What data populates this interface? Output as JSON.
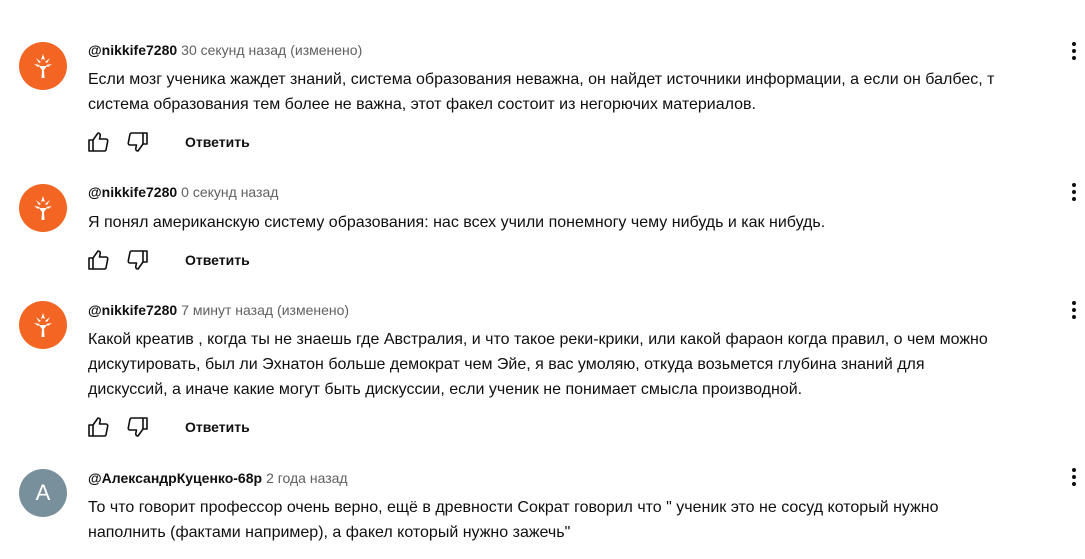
{
  "comments": [
    {
      "author": "@nikkife7280",
      "time": "30 секунд назад",
      "edited": "(изменено)",
      "lines": [
        "Если мозг ученика жаждет знаний, система образования неважна, он найдет источники информации, а если он балбес, т",
        "система образования тем более не важна, этот факел состоит из негорючих материалов."
      ],
      "reply_label": "Ответить",
      "avatar_icon": "torch-icon"
    },
    {
      "author": "@nikkife7280",
      "time": "0 секунд назад",
      "edited": "",
      "lines": [
        "Я понял американскую систему образования: нас всех учили понемногу чему нибудь и как нибудь."
      ],
      "reply_label": "Ответить",
      "avatar_icon": "torch-icon"
    },
    {
      "author": "@nikkife7280",
      "time": "7 минут назад",
      "edited": "(изменено)",
      "lines": [
        "Какой креатив , когда ты не знаешь где Австралия, и что такое реки-крики, или какой фараон когда правил, о чем можно",
        "дискутировать, был ли Эхнатон больше демократ чем Эйе, я вас умоляю, откуда возьмется глубина знаний для",
        "дискуссий, а иначе какие могут быть дискуссии, если ученик не понимает смысла производной."
      ],
      "reply_label": "Ответить",
      "avatar_icon": "torch-icon"
    },
    {
      "author": "@АлександрКуценко-68р",
      "time": "2 года назад",
      "edited": "",
      "lines": [
        "То что говорит профессор очень верно, ещё в древности Сократ говорил что \" ученик это не сосуд который нужно",
        "наполнить (фактами например), а факел который нужно зажечь\""
      ],
      "reply_label": "",
      "avatar_letter": "A"
    }
  ],
  "colors": {
    "torch_avatar": "#f26522",
    "letter_avatar": "#78909c",
    "meta_text": "#606060"
  }
}
